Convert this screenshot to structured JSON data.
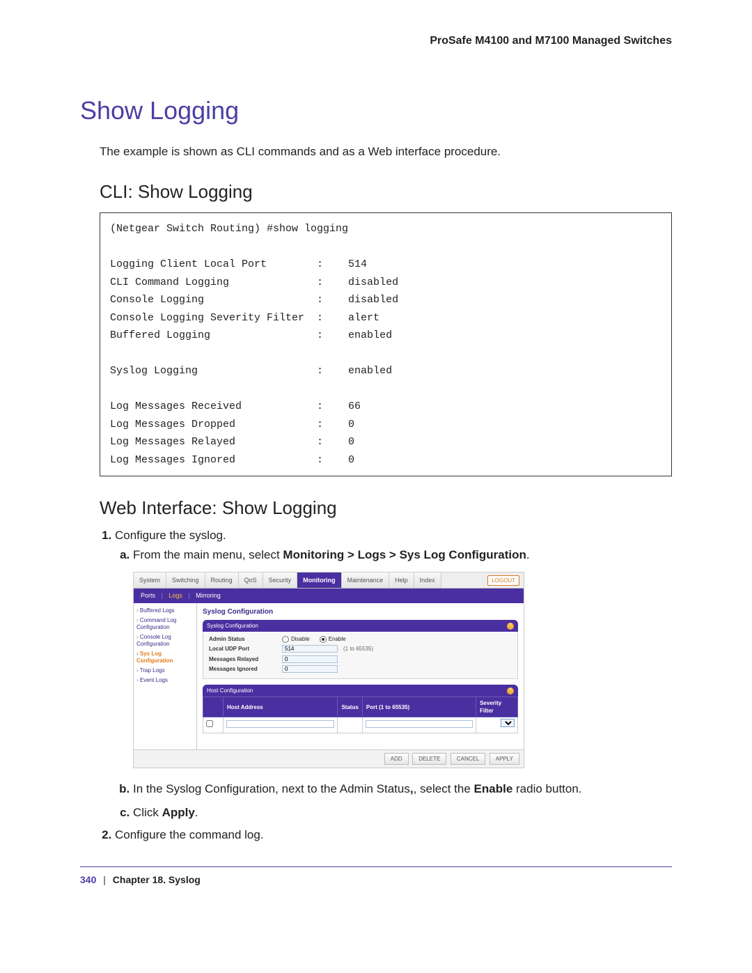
{
  "header": {
    "product_line": "ProSafe M4100 and M7100 Managed Switches"
  },
  "section": {
    "title": "Show Logging",
    "intro": "The example is shown as CLI commands and as a Web interface procedure."
  },
  "cli": {
    "title": "CLI: Show Logging",
    "text": "(Netgear Switch Routing) #show logging\n\nLogging Client Local Port        :    514\nCLI Command Logging              :    disabled\nConsole Logging                  :    disabled\nConsole Logging Severity Filter  :    alert\nBuffered Logging                 :    enabled\n\nSyslog Logging                   :    enabled\n\nLog Messages Received            :    66\nLog Messages Dropped             :    0\nLog Messages Relayed             :    0\nLog Messages Ignored             :    0"
  },
  "web": {
    "title": "Web Interface: Show Logging",
    "steps": {
      "s1": "Configure the syslog.",
      "s1a_pre": "From the main menu, select ",
      "s1a_bold": "Monitoring > Logs > Sys Log Configuration",
      "s1a_post": ".",
      "s1b_pre": "In the Syslog Configuration, next to the Admin Status",
      "s1b_mid": ", select the ",
      "s1b_bold": "Enable",
      "s1b_post": " radio button.",
      "s1c_pre": "Click ",
      "s1c_bold": "Apply",
      "s1c_post": ".",
      "s2": "Configure the command log."
    }
  },
  "shot": {
    "tabs": [
      "System",
      "Switching",
      "Routing",
      "QoS",
      "Security",
      "Monitoring",
      "Maintenance",
      "Help",
      "Index"
    ],
    "logout": "LOGOUT",
    "subtabs": {
      "a": "Ports",
      "b": "Logs",
      "c": "Mirroring"
    },
    "sidebar": [
      "Buffered Logs",
      "Command Log Configuration",
      "Console Log Configuration",
      "Sys Log Configuration",
      "Trap Logs",
      "Event Logs"
    ],
    "main_title": "Syslog Configuration",
    "panel1_title": "Syslog Configuration",
    "rows": {
      "admin_status": "Admin Status",
      "disable": "Disable",
      "enable": "Enable",
      "local_udp": "Local UDP Port",
      "local_udp_val": "514",
      "local_udp_hint": "(1 to 65535)",
      "relayed": "Messages Relayed",
      "relayed_val": "0",
      "ignored": "Messages Ignored",
      "ignored_val": "0"
    },
    "panel2_title": "Host Configuration",
    "host_cols": [
      "Host Address",
      "Status",
      "Port (1 to 65535)",
      "Severity Filter"
    ],
    "buttons": [
      "ADD",
      "DELETE",
      "CANCEL",
      "APPLY"
    ]
  },
  "footer": {
    "page": "340",
    "chapter": "Chapter 18.  Syslog"
  }
}
